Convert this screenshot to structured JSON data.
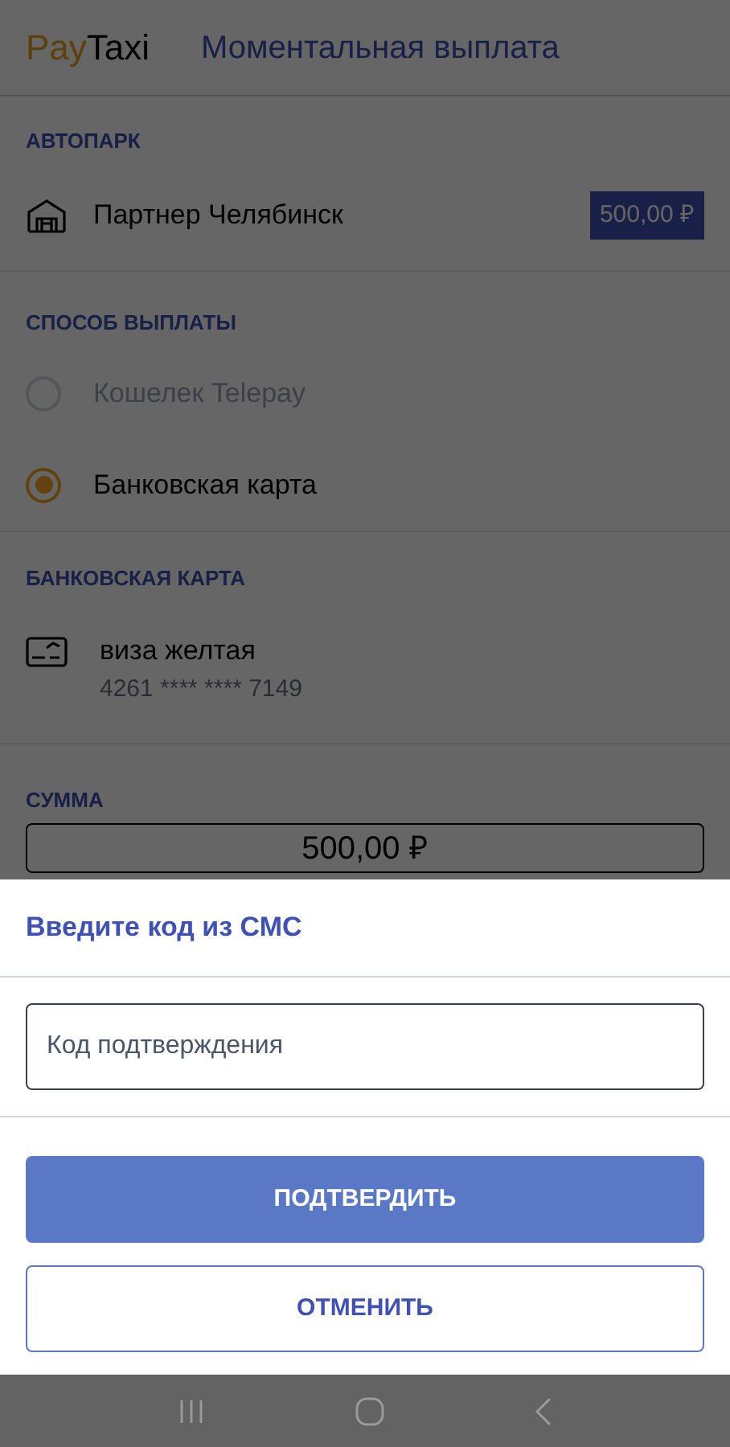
{
  "header": {
    "logo_part_1": "Pay",
    "logo_part_2": "Taxi",
    "title": "Моментальная выплата"
  },
  "fleet": {
    "label": "АВТОПАРК",
    "name": "Партнер Челябинск",
    "balance": "500,00 ₽"
  },
  "payout_method": {
    "label": "СПОСОБ ВЫПЛАТЫ",
    "options": [
      {
        "label": "Кошелек Telepay",
        "selected": false,
        "disabled": true
      },
      {
        "label": "Банковская карта",
        "selected": true,
        "disabled": false
      }
    ]
  },
  "bank_card": {
    "label": "БАНКОВСКАЯ КАРТА",
    "name": "виза желтая",
    "number": "4261 **** **** 7149"
  },
  "amount": {
    "label": "СУММА",
    "value": "500,00 ₽"
  },
  "sms_dialog": {
    "title": "Введите код из СМС",
    "placeholder": "Код подтверждения",
    "confirm": "ПОДТВЕРДИТЬ",
    "cancel": "ОТМЕНИТЬ"
  }
}
